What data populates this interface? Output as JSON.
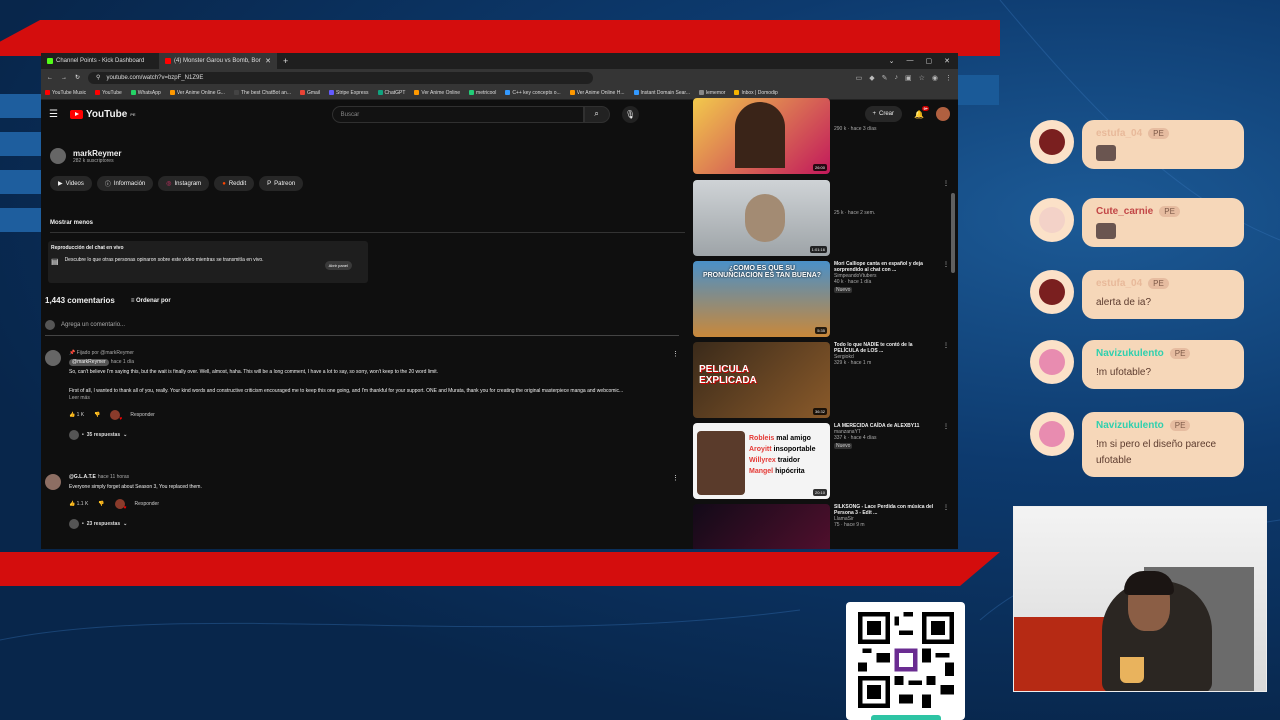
{
  "browser": {
    "tabs": [
      {
        "label": "Channel Points - Kick Dashboard",
        "active": false
      },
      {
        "label": "(4) Monster Garou vs Bomb, Bor",
        "active": true
      }
    ],
    "url": "youtube.com/watch?v=bzpF_N1Z9E",
    "bookmarks": [
      "YouTube Music",
      "YouTube",
      "WhatsApp",
      "Ver Anime Online G...",
      "The best ChatBot an...",
      "Gmail",
      "Stripe Express",
      "ChatGPT",
      "Ver Anime Online",
      "metricool",
      "C++ key concepts o...",
      "Ver Anime Online H...",
      "Instant Domain Sear...",
      "lememor",
      "Inbox | Domodip"
    ]
  },
  "youtube": {
    "logo": "YouTube",
    "logo_region": "PE",
    "search_placeholder": "Buscar",
    "create_label": "Crear",
    "notif_count": "9+",
    "channel": {
      "name": "markReymer",
      "subs": "282 k suscriptores"
    },
    "links": [
      {
        "icon": "▶",
        "label": "Videos"
      },
      {
        "icon": "ⓘ",
        "label": "Información"
      },
      {
        "icon": "◎",
        "label": "Instagram"
      },
      {
        "icon": "●",
        "label": "Reddit"
      },
      {
        "icon": "P",
        "label": "Patreon"
      }
    ],
    "show_less": "Mostrar menos",
    "chat_replay": {
      "title": "Reproducción del chat en vivo",
      "desc": "Descubre lo que otras personas opinaron sobre este video mientras se transmitía en vivo.",
      "button": "Abrir panel"
    },
    "comments_count": "1,443 comentarios",
    "sort_label": "Ordenar por",
    "add_comment": "Agrega un comentario...",
    "comments": [
      {
        "pinned": "Fijado por @markReymer",
        "author": "@markReymer",
        "time": "hace 1 día",
        "text1": "So, can't believe I'm saying this, but the wait is finally over. Well, almost, haha. This will be a long comment, I have a lot to say, so sorry, won't keep to the 20 word limit.",
        "text2": "First of all, I wanted to thank all of you, really. Your kind words and constructive criticism encouraged me to keep this one going, and I'm thankful for your support. ONE and Murata, thank you for creating the original masterpiece manga and webcomic...",
        "more": "Leer más",
        "likes": "1 K",
        "reply": "Responder",
        "replies": "35 respuestas"
      },
      {
        "author": "@G.L.A.T.E",
        "time": "hace 11 horas",
        "text1": "Everyone simply forget about Season 3, You replaced them.",
        "likes": "1.1 K",
        "reply": "Responder",
        "replies": "23 respuestas"
      }
    ],
    "related": [
      {
        "title": "",
        "channel": "",
        "meta": "290 k · hace 3 días",
        "duration": "26:00",
        "new": ""
      },
      {
        "title": "",
        "channel": "",
        "meta": "25 k · hace 2 sem.",
        "duration": "1:01:16",
        "new": ""
      },
      {
        "title": "Mori Calliope canta en español y deja sorprendido al chat con ...",
        "channel": "SimpeandoVtubers",
        "meta": "40 k · hace 1 día",
        "duration": "5:35",
        "new": "Nuevo",
        "thumb_text": "¿COMO ES QUE SU PRONUNCIACION ES TAN BUENA?"
      },
      {
        "title": "Todo lo que NADIE te contó de la PELÍCULA de LOS ...",
        "channel": "Sergiokd",
        "meta": "329 k · hace 1 m",
        "duration": "36:32",
        "new": "",
        "thumb_text": "PELICULA EXPLICADA"
      },
      {
        "title": "LA MERECIDA CAÍDA de ALEXBY11",
        "channel": "manzanaYT",
        "meta": "337 k · hace 4 días",
        "duration": "20:10",
        "new": "Nuevo",
        "thumb_lines": [
          "mal amigo",
          "insoportable",
          "traidor",
          "hipócrita"
        ],
        "thumb_names": [
          "Robleis",
          "Aroyitt",
          "Willyrex",
          "Mangel"
        ]
      },
      {
        "title": "SILKSONG - Lace Perdida con música del Persona 3 - Edit ...",
        "channel": "LlamaSir",
        "meta": "75 · hace 9 m",
        "duration": "",
        "new": ""
      }
    ]
  },
  "chat": [
    {
      "user": "estufa_04",
      "badge": "PE",
      "text": "",
      "emote": true,
      "user_color": "#e8b99a",
      "icon_color": "#7a1f1f"
    },
    {
      "user": "Cute_carnie",
      "badge": "PE",
      "text": "",
      "emote": true,
      "user_color": "#c24646",
      "icon_color": "#f3d2c8"
    },
    {
      "user": "estufa_04",
      "badge": "PE",
      "text": "alerta de ia?",
      "emote": false,
      "user_color": "#e8b99a",
      "icon_color": "#7a1f1f"
    },
    {
      "user": "Navizukulento",
      "badge": "PE",
      "text": "!m ufotable?",
      "emote": false,
      "user_color": "#2fd0ae",
      "icon_color": "#e88cb0"
    },
    {
      "user": "Navizukulento",
      "badge": "PE",
      "text": "!m si pero el diseño parece ufotable",
      "emote": false,
      "user_color": "#2fd0ae",
      "icon_color": "#e88cb0"
    }
  ],
  "colors": {
    "yt_red": "#ff0000",
    "overlay_red": "#d40d0d",
    "bubble": "#f6d7b9",
    "qr_accent": "#2ec4a4"
  }
}
